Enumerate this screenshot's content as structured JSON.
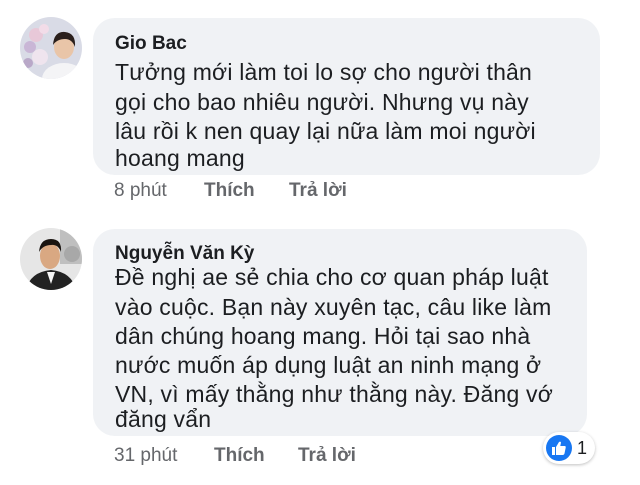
{
  "comments": [
    {
      "author": "Gio Bac",
      "lines": [
        "Tưởng  mới  làm  toi lo sợ  cho người  thân",
        "gọi  cho bao nhiêu  người.  Nhưng  vụ  này",
        "lâu  rồi  k nen quay lại  nữa  làm  moi người",
        "hoang mang"
      ],
      "time": "8 phút",
      "like_label": "Thích",
      "reply_label": "Trả lời"
    },
    {
      "author": "Nguyễn Văn Kỳ",
      "lines": [
        "Đề nghị ae sẻ chia cho cơ quan pháp luật",
        "vào cuộc. Bạn này xuyên tạc, câu like làm",
        "dân chúng hoang mang. Hỏi tại sao nhà",
        "nước muốn áp dụng luật an ninh mạng ở",
        "VN, vì mấy thằng như thằng này. Đăng vớ",
        "đăng vẩn"
      ],
      "time": "31 phút",
      "like_label": "Thích",
      "reply_label": "Trả lời",
      "reaction": {
        "icon": "like-icon",
        "count": "1",
        "color": "#1877f2"
      }
    }
  ],
  "colors": {
    "bubble": "#f0f2f5",
    "text": "#1c1e21",
    "meta": "#65676b"
  }
}
